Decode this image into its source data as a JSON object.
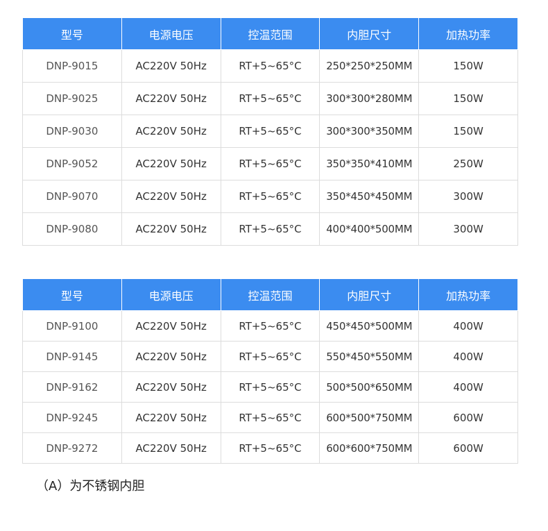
{
  "headers": [
    "型号",
    "电源电压",
    "控温范围",
    "内胆尺寸",
    "加热功率"
  ],
  "table1": [
    [
      "DNP-9015",
      "AC220V 50Hz",
      "RT+5~65°C",
      "250*250*250MM",
      "150W"
    ],
    [
      "DNP-9025",
      "AC220V 50Hz",
      "RT+5~65°C",
      "300*300*280MM",
      "150W"
    ],
    [
      "DNP-9030",
      "AC220V 50Hz",
      "RT+5~65°C",
      "300*300*350MM",
      "150W"
    ],
    [
      "DNP-9052",
      "AC220V 50Hz",
      "RT+5~65°C",
      "350*350*410MM",
      "250W"
    ],
    [
      "DNP-9070",
      "AC220V 50Hz",
      "RT+5~65°C",
      "350*450*450MM",
      "300W"
    ],
    [
      "DNP-9080",
      "AC220V 50Hz",
      "RT+5~65°C",
      "400*400*500MM",
      "300W"
    ]
  ],
  "table2": [
    [
      "DNP-9100",
      "AC220V 50Hz",
      "RT+5~65°C",
      "450*450*500MM",
      "400W"
    ],
    [
      "DNP-9145",
      "AC220V 50Hz",
      "RT+5~65°C",
      "550*450*550MM",
      "400W"
    ],
    [
      "DNP-9162",
      "AC220V 50Hz",
      "RT+5~65°C",
      "500*500*650MM",
      "400W"
    ],
    [
      "DNP-9245",
      "AC220V 50Hz",
      "RT+5~65°C",
      "600*500*750MM",
      "600W"
    ],
    [
      "DNP-9272",
      "AC220V 50Hz",
      "RT+5~65°C",
      "600*600*750MM",
      "600W"
    ]
  ],
  "note": "（A）为不锈钢内胆",
  "colors": {
    "header_bg": "#3b8cf0",
    "header_text": "#ffffff",
    "border": "#dcdcdc"
  }
}
